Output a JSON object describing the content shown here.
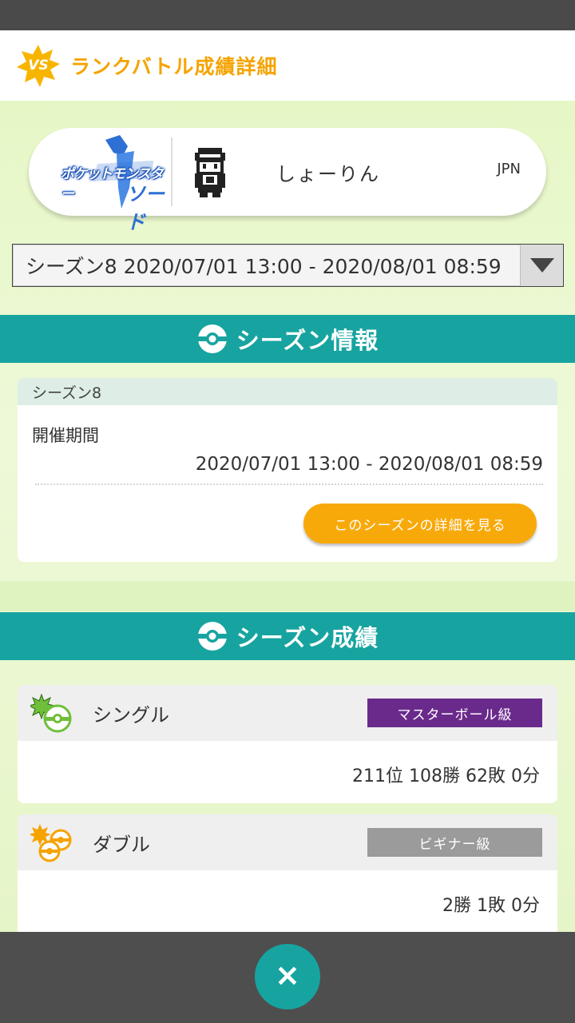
{
  "header": {
    "badge": "VS",
    "title": "ランクバトル成績詳細"
  },
  "profile": {
    "game_logo_text": "ポケットモンスター",
    "game_logo_sub": "ソード",
    "player_name": "しょーりん",
    "region": "JPN"
  },
  "season_select": {
    "value": "シーズン8 2020/07/01 13:00 - 2020/08/01 08:59"
  },
  "season_info": {
    "section_title": "シーズン情報",
    "season_name": "シーズン8",
    "period_label": "開催期間",
    "period": "2020/07/01 13:00 - 2020/08/01 08:59",
    "detail_button": "このシーズンの詳細を見る"
  },
  "season_results": {
    "section_title": "シーズン成績",
    "single": {
      "name": "シングル",
      "rank": "マスターボール級",
      "rank_color": "#6a2a8c",
      "stats": "211位 108勝 62敗 0分"
    },
    "double": {
      "name": "ダブル",
      "rank": "ビギナー級",
      "rank_color": "#9b9b9b",
      "stats": "2勝 1敗 0分"
    }
  },
  "colors": {
    "accent": "#17a4a0",
    "orange": "#f8a90a",
    "title": "#f5a300"
  }
}
